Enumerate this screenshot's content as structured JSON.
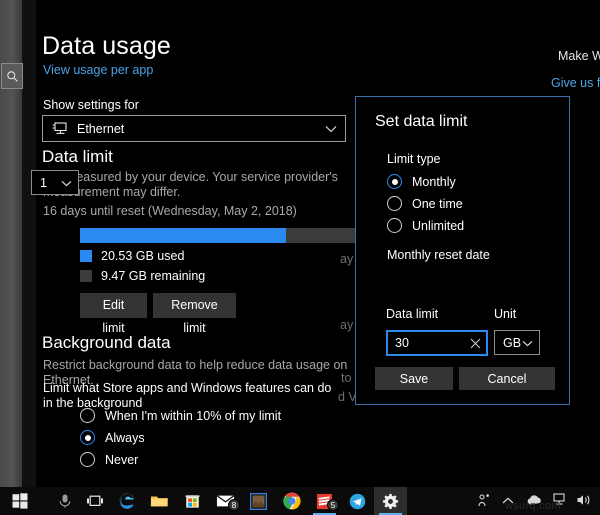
{
  "window": {
    "page_title": "Data usage",
    "view_usage_link": "View usage per app",
    "show_settings_label": "Show settings for",
    "network_combo_value": "Ethernet",
    "data_limit_heading": "Data limit",
    "measured_note": "*As measured by your device. Your service provider's measurement may differ.",
    "reset_note": "16 days until reset (Wednesday, May 2, 2018)",
    "used_legend": "20.53 GB used",
    "remaining_legend": "9.47 GB remaining",
    "edit_limit_button": "Edit limit",
    "remove_limit_button": "Remove limit",
    "background_data_heading": "Background data",
    "background_data_note": "Restrict background data to help reduce data usage on Ethernet.",
    "background_data_question": "Limit what Store apps and Windows features can do in the background",
    "background_options": [
      {
        "label": "When I'm within 10% of my limit",
        "selected": false
      },
      {
        "label": "Always",
        "selected": true
      },
      {
        "label": "Never",
        "selected": false
      }
    ]
  },
  "usage": {
    "used_gb": 20.53,
    "remaining_gb": 9.47,
    "total_gb": 30,
    "percent_used": 68.4,
    "used_color": "#2a8aef",
    "remaining_color": "#3b3b3b"
  },
  "feedback": {
    "make_windows_better": "Make Wind",
    "give_us_feedback": "Give us fee"
  },
  "fragments": {
    "f1": "ay",
    "f2": "ay",
    "f3": "to",
    "f4": "d V"
  },
  "dialog": {
    "title": "Set data limit",
    "limit_type_label": "Limit type",
    "limit_type_options": [
      {
        "label": "Monthly",
        "selected": true
      },
      {
        "label": "One time",
        "selected": false
      },
      {
        "label": "Unlimited",
        "selected": false
      }
    ],
    "reset_date_label": "Monthly reset date",
    "reset_date_value": "1",
    "data_limit_label": "Data limit",
    "data_limit_value": "30",
    "data_limit_placeholder": "",
    "unit_label": "Unit",
    "unit_value": "GB",
    "save_button": "Save",
    "cancel_button": "Cancel",
    "border_color": "#3f6fa8",
    "focus_color": "#2a8aef"
  },
  "taskbar": {
    "items": [
      {
        "name": "start-button",
        "icon": "windows-logo"
      },
      {
        "name": "cortana-search",
        "icon": "microphone-icon"
      },
      {
        "name": "task-view",
        "icon": "task-view-icon"
      },
      {
        "name": "microsoft-edge",
        "icon": "edge-icon",
        "running": true
      },
      {
        "name": "file-explorer",
        "icon": "folder-icon",
        "running": true
      },
      {
        "name": "microsoft-store",
        "icon": "store-icon"
      },
      {
        "name": "mail",
        "icon": "envelope-icon",
        "badge": "8"
      },
      {
        "name": "photos",
        "icon": "photo-icon"
      },
      {
        "name": "google-chrome",
        "icon": "chrome-icon"
      },
      {
        "name": "sticky-app",
        "icon": "red-stack-icon",
        "badge": "5",
        "running": true
      },
      {
        "name": "telegram",
        "icon": "telegram-icon"
      },
      {
        "name": "settings",
        "icon": "gear-icon",
        "running": true,
        "active": true
      }
    ],
    "tray": [
      {
        "name": "people-icon"
      },
      {
        "name": "show-hidden-icons-chevron"
      },
      {
        "name": "onedrive-cloud-icon"
      },
      {
        "name": "network-icon"
      },
      {
        "name": "volume-icon"
      }
    ]
  }
}
